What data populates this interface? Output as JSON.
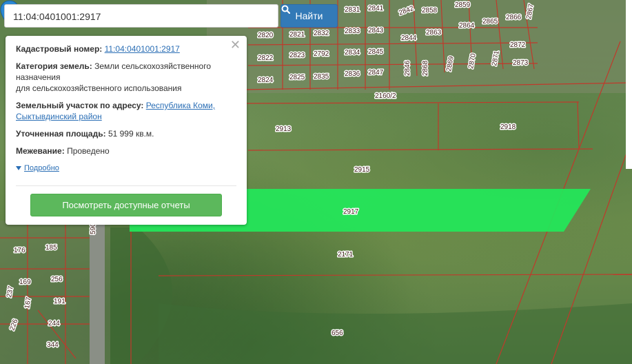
{
  "search": {
    "value": "11:04:0401001:2917",
    "button_label": "Найти",
    "button_icon": "search-icon"
  },
  "popup": {
    "cadastral_label": "Кадастровый номер:",
    "cadastral_value": "11:04:0401001:2917",
    "category_label": "Категория земель:",
    "category_value": "Земли сельскохозяйственного назначения",
    "category_value_2": "для сельскохозяйственного использования",
    "address_label": "Земельный участок по адресу:",
    "address_value_1": "Республика Коми,",
    "address_value_2": "Сыктывдинский район",
    "area_label": "Уточненная площадь:",
    "area_value": "51 999 кв.м.",
    "survey_label": "Межевание:",
    "survey_value": "Проведено",
    "more_label": "Подробно",
    "report_button": "Посмотреть доступные отчеты",
    "close_icon": "close-icon"
  },
  "map": {
    "highlight_color": "#22e85a",
    "boundary_color": "#c0392b",
    "parcel_labels": [
      "2831",
      "2841",
      "2842",
      "2858",
      "2859",
      "2866",
      "2867",
      "2864",
      "2865",
      "2820",
      "2821",
      "2832",
      "2833",
      "2843",
      "2844",
      "2863",
      "2822",
      "2823",
      "2792",
      "2834",
      "2845",
      "2846",
      "2868",
      "2869",
      "2870",
      "2871",
      "2872",
      "2873",
      "2824",
      "2825",
      "2835",
      "2836",
      "2847",
      "2160/2",
      "2913",
      "2918",
      "2915",
      "2917",
      "2171",
      "176",
      "185",
      "169",
      "256",
      "237",
      "167",
      "191",
      "226",
      "244",
      "344",
      "656",
      "590"
    ]
  }
}
